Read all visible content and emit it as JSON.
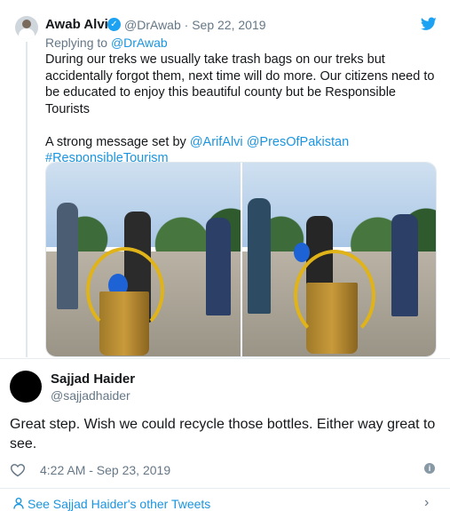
{
  "tweet": {
    "author_name": "Awab Alvi",
    "author_handle": "@DrAwab",
    "date_sep": " · ",
    "date": "Sep 22, 2019",
    "replying_prefix": "Replying to ",
    "replying_to": "@DrAwab",
    "text_line1": "During our treks we usually take trash bags on our treks but accidentally forgot them, next time will do more. Our citizens need to be educated to enjoy this beautiful county but be Responsible Tourists",
    "text_line2_prefix": "A strong message set by ",
    "mention1": "@ArifAlvi",
    "mention2": "@PresOfPakistan",
    "hashtag": "#ResponsibleTourism"
  },
  "reply": {
    "author_name": "Sajjad Haider",
    "author_handle": "@sajjadhaider",
    "text": "Great step. Wish we could recycle those bottles. Either way  great to see.",
    "timestamp": "4:22 AM - Sep 23, 2019"
  },
  "footer": {
    "see_more": "See Sajjad Haider's other Tweets"
  },
  "icons": {
    "verified": "verified-icon",
    "bird": "twitter-bird-icon",
    "heart": "heart-icon",
    "info": "info-icon",
    "person": "person-icon",
    "chevron": "chevron-right-icon"
  },
  "colors": {
    "link": "#1b95e0",
    "twitter_blue": "#1da1f2",
    "muted": "#657786"
  }
}
